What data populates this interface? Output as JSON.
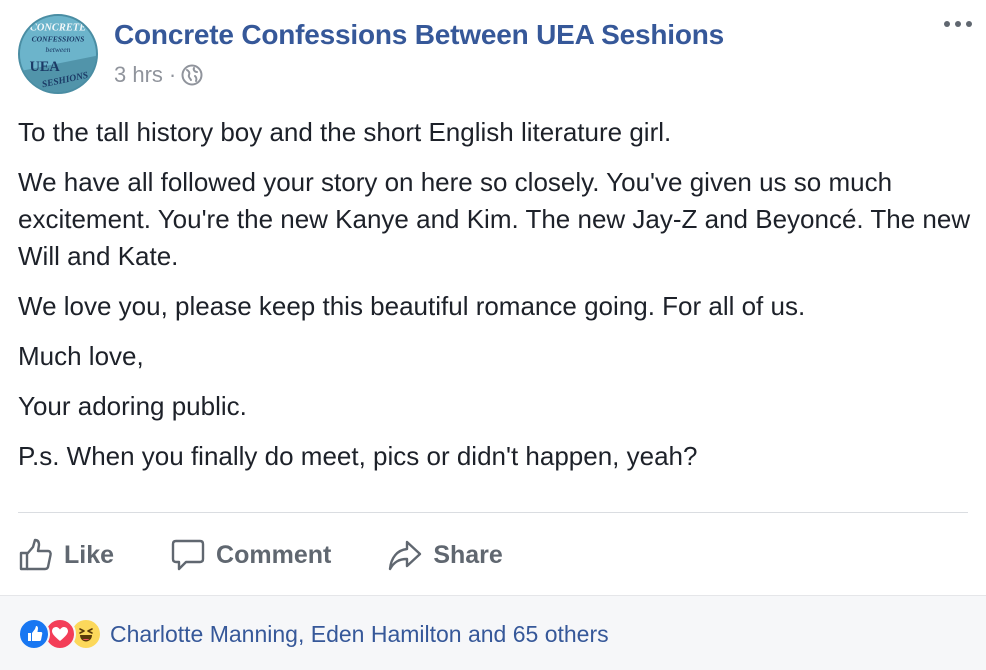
{
  "post": {
    "page_name": "Concrete Confessions Between UEA Seshions",
    "timestamp": "3 hrs",
    "separator": "·",
    "privacy_icon": "globe-icon",
    "avatar_text": {
      "line1": "CONCRETE",
      "line2": "CONFESSIONS",
      "line3": "between",
      "line4": "UEA",
      "line5": "SESHIONS"
    },
    "paragraphs": [
      "To the tall history boy and the short English literature girl.",
      "We have all followed your story on here so closely. You've given us so much excitement. You're the new Kanye and Kim. The new Jay-Z and Beyoncé. The new Will and Kate.",
      "We love you, please keep this beautiful romance going. For all of us.",
      "Much love,",
      "Your adoring public.",
      "P.s. When you finally do meet, pics or didn't happen, yeah?"
    ]
  },
  "actions": {
    "like_label": "Like",
    "comment_label": "Comment",
    "share_label": "Share"
  },
  "footer": {
    "reaction_icons": [
      "like-icon",
      "love-icon",
      "haha-icon"
    ],
    "reactors_text": "Charlotte Manning, Eden Hamilton and 65 others"
  },
  "colors": {
    "link": "#365899",
    "secondary_text": "#90949c",
    "action_text": "#606770",
    "like": "#1877f2",
    "love": "#f33e58",
    "haha": "#fcd85b"
  }
}
